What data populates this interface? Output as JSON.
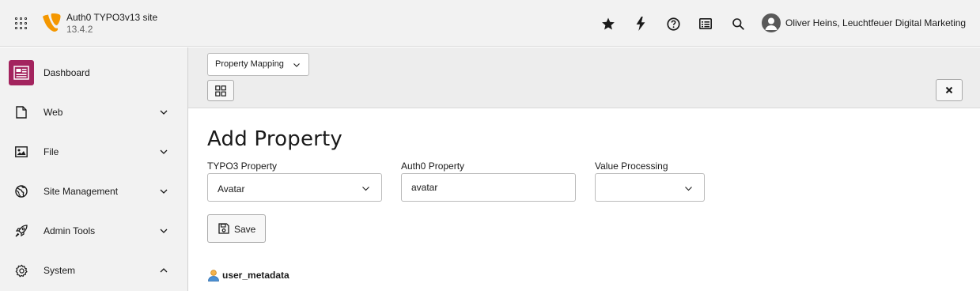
{
  "topbar": {
    "site_title": "Auth0 TYPO3v13 site",
    "site_version": "13.4.2",
    "icons": [
      "app-menu-icon",
      "star-icon",
      "bolt-icon",
      "help-icon",
      "list-icon",
      "search-icon"
    ],
    "user_name": "Oliver Heins, Leuchtfeuer Digital Marketing"
  },
  "sidebar": {
    "items": [
      {
        "label": "Dashboard",
        "icon": "dashboard-icon",
        "expanded": null
      },
      {
        "label": "Web",
        "icon": "page-icon",
        "expanded": false
      },
      {
        "label": "File",
        "icon": "image-icon",
        "expanded": false
      },
      {
        "label": "Site Management",
        "icon": "globe-icon",
        "expanded": false
      },
      {
        "label": "Admin Tools",
        "icon": "rocket-icon",
        "expanded": false
      },
      {
        "label": "System",
        "icon": "gear-icon",
        "expanded": true
      }
    ]
  },
  "docheader": {
    "module_menu_value": "Property Mapping"
  },
  "main": {
    "heading": "Add Property",
    "typo3_property_label": "TYPO3 Property",
    "typo3_property_value": "Avatar",
    "auth0_property_label": "Auth0 Property",
    "auth0_property_value": "avatar",
    "value_processing_label": "Value Processing",
    "value_processing_value": "",
    "save_label": "Save",
    "metadata_label": "user_metadata"
  },
  "colors": {
    "accent_dashboard": "#a3245e",
    "typo3_orange": "#f49700",
    "topbar_bg": "#f2f2f2"
  }
}
